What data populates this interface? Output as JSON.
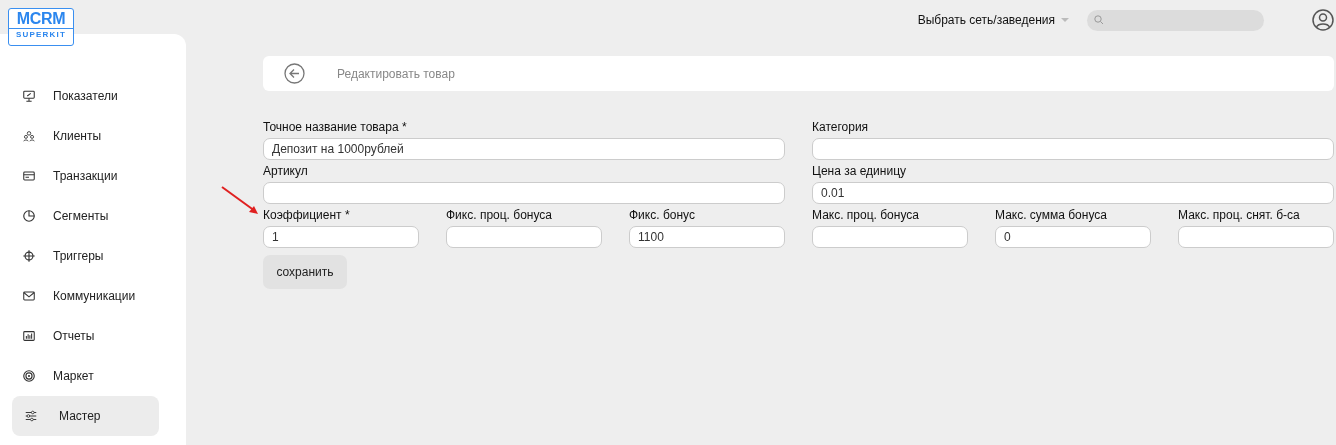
{
  "logo": {
    "title": "MCRM",
    "subtitle": "SUPERKIT"
  },
  "header": {
    "network_select": "Выбрать сеть/заведения"
  },
  "sidebar": {
    "items": [
      {
        "label": "Показатели",
        "selected": false
      },
      {
        "label": "Клиенты",
        "selected": false
      },
      {
        "label": "Транзакции",
        "selected": false
      },
      {
        "label": "Сегменты",
        "selected": false
      },
      {
        "label": "Триггеры",
        "selected": false
      },
      {
        "label": "Коммуникации",
        "selected": false
      },
      {
        "label": "Отчеты",
        "selected": false
      },
      {
        "label": "Маркет",
        "selected": false
      },
      {
        "label": "Мастер",
        "selected": true
      }
    ]
  },
  "page": {
    "title": "Редактировать товар"
  },
  "form": {
    "fields": [
      {
        "label": "Точное название товара *",
        "value": "Депозит на 1000рублей",
        "kind": "wide"
      },
      {
        "label": "Категория",
        "kind": "wide"
      },
      {
        "label": "Артикул",
        "kind": "wide"
      },
      {
        "label": "Цена за единицу",
        "value": "0.01",
        "kind": "wide"
      },
      {
        "label": "Коэффициент *",
        "value": "1",
        "kind": "narrow"
      },
      {
        "label": "Фикс. проц. бонуса",
        "kind": "narrow"
      },
      {
        "label": "Фикс. бонус",
        "value": "1100",
        "kind": "narrow"
      },
      {
        "label": "Макс. проц. бонуса",
        "kind": "narrow"
      },
      {
        "label": "Макс. сумма бонуса",
        "value": "0",
        "kind": "narrow"
      },
      {
        "label": "Макс. проц. снят. б-са",
        "kind": "narrow"
      }
    ],
    "submit": "сохранить"
  }
}
